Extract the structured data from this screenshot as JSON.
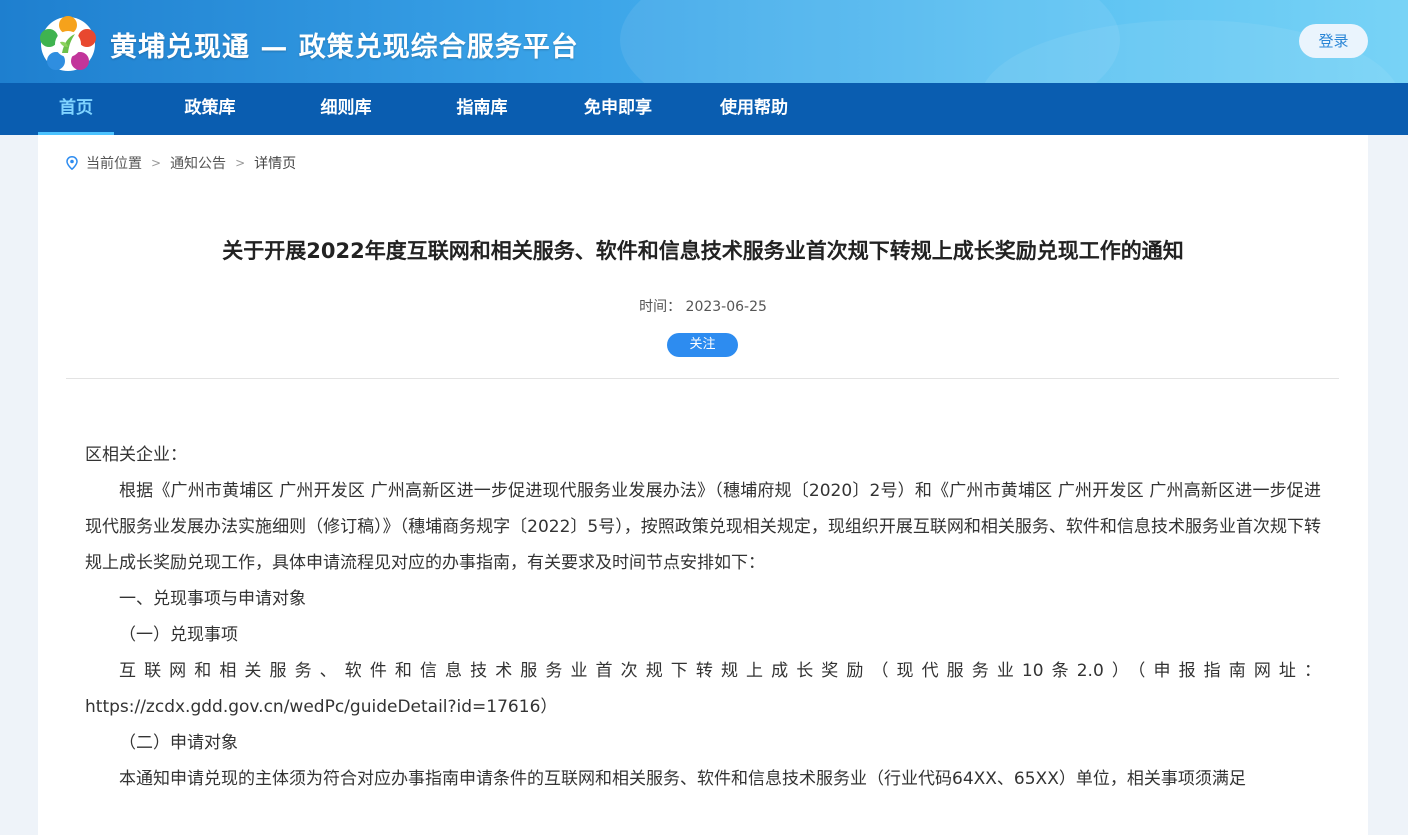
{
  "header": {
    "site_title": "黄埔兑现通 — 政策兑现综合服务平台",
    "login_label": "登录",
    "logo_icon": "flower-logo-icon",
    "colors": {
      "header_start": "#1e7fcf",
      "header_end": "#78d3f6",
      "nav_bg": "#0a5db0",
      "nav_active": "#7fd3ff",
      "accent_button": "#2d8cf0"
    }
  },
  "nav": {
    "items": [
      {
        "label": "首页",
        "active": true
      },
      {
        "label": "政策库"
      },
      {
        "label": "细则库"
      },
      {
        "label": "指南库"
      },
      {
        "label": "免申即享"
      },
      {
        "label": "使用帮助"
      }
    ]
  },
  "breadcrumb": {
    "prefix": "当前位置",
    "items": [
      "通知公告",
      "详情页"
    ],
    "separator": ">"
  },
  "article": {
    "title": "关于开展2022年度互联网和相关服务、软件和信息技术服务业首次规下转规上成长奖励兑现工作的通知",
    "time_label": "时间：",
    "time_value": "2023-06-25",
    "follow_label": "关注",
    "paragraphs": [
      "区相关企业：",
      "根据《广州市黄埔区 广州开发区 广州高新区进一步促进现代服务业发展办法》（穗埔府规〔2020〕2号）和《广州市黄埔区 广州开发区 广州高新区进一步促进现代服务业发展办法实施细则（修订稿）》（穗埔商务规字〔2022〕5号），按照政策兑现相关规定，现组织开展互联网和相关服务、软件和信息技术服务业首次规下转规上成长奖励兑现工作，具体申请流程见对应的办事指南，有关要求及时间节点安排如下：",
      "一、兑现事项与申请对象",
      "（一）兑现事项",
      "互联网和相关服务、软件和信息技术服务业首次规下转规上成长奖励（现代服务业10条2.0）（申报指南网址：",
      "https://zcdx.gdd.gov.cn/wedPc/guideDetail?id=17616）",
      "（二）申请对象",
      "本通知申请兑现的主体须为符合对应办事指南申请条件的互联网和相关服务、软件和信息技术服务业（行业代码64XX、65XX）单位，相关事项须满足"
    ]
  }
}
